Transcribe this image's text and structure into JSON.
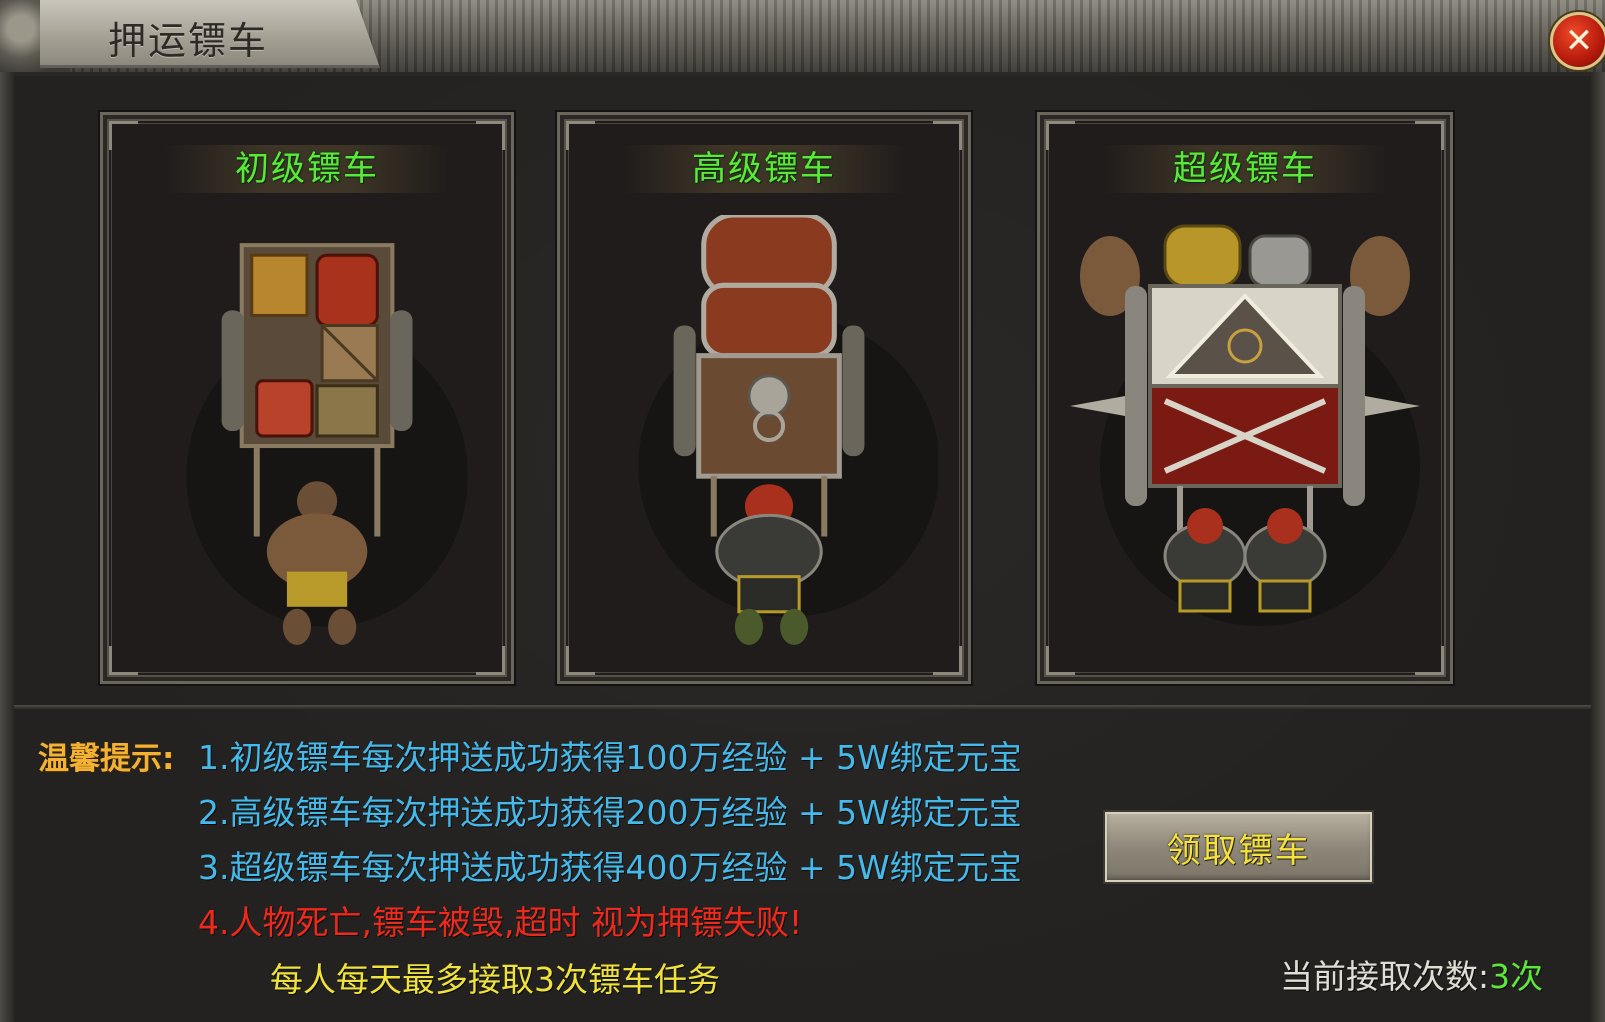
{
  "window": {
    "title": "押运镖车",
    "close_label": "✕"
  },
  "carts": [
    {
      "name": "初级镖车",
      "tier": "basic"
    },
    {
      "name": "高级镖车",
      "tier": "advanced"
    },
    {
      "name": "超级镖车",
      "tier": "super"
    }
  ],
  "tips": {
    "label": "温馨提示:",
    "lines": [
      "1.初级镖车每次押送成功获得100万经验 + 5W绑定元宝",
      "2.高级镖车每次押送成功获得200万经验 + 5W绑定元宝",
      "3.超级镖车每次押送成功获得400万经验 + 5W绑定元宝",
      "4.人物死亡,镖车被毁,超时 视为押镖失败!"
    ],
    "daily_limit": "每人每天最多接取3次镖车任务"
  },
  "actions": {
    "accept_label": "领取镖车"
  },
  "status": {
    "count_label": "当前接取次数:",
    "count_value": "3次"
  },
  "colors": {
    "title_green": "#5ce83a",
    "tip_blue": "#45b9ea",
    "tip_red": "#ef2a1c",
    "tip_gold": "#f3b233",
    "note_yellow": "#f0e23c"
  }
}
